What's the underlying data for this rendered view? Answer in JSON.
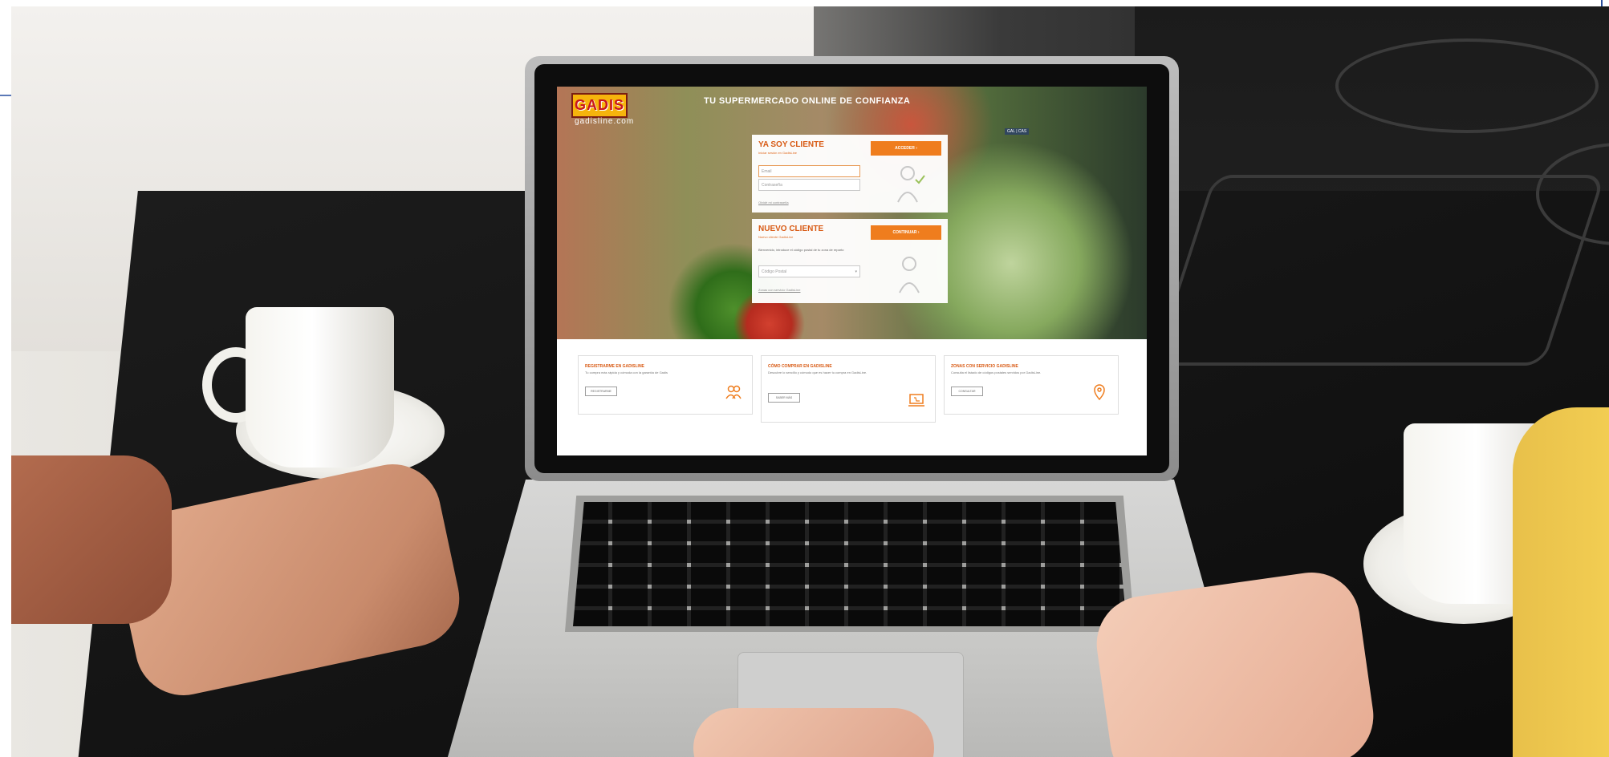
{
  "site": {
    "logo": "GADIS",
    "domain": "gadisline.com",
    "tagline": "TU SUPERMERCADO ONLINE DE CONFIANZA",
    "language": "GAL | CAS"
  },
  "login": {
    "title": "YA SOY CLIENTE",
    "subtitle": "Iniciar sesión en GadisLine",
    "button": "ACCEDER",
    "email_placeholder": "Email",
    "password_placeholder": "Contraseña",
    "forgot": "Olvidé mi contraseña"
  },
  "signup": {
    "title": "NUEVO CLIENTE",
    "subtitle": "Nuevo cliente GadisLine",
    "button": "CONTINUAR",
    "description": "Bienvenido, introduce el código postal de tu zona de reparto",
    "postal_placeholder": "Código Postal",
    "link": "Zonas con servicio GadisLine"
  },
  "cards": [
    {
      "title": "REGISTRARME EN GADISLINE",
      "desc": "Tu compra más rápida y cómoda con la garantía de Gadis",
      "button": "REGISTRARME",
      "icon": "users-icon"
    },
    {
      "title": "CÓMO COMPRAR EN GADISLINE",
      "desc": "Descubre lo sencillo y cómodo que es hacer tu compra en GadisLine.",
      "button": "SABER MÁS",
      "icon": "laptop-cart-icon"
    },
    {
      "title": "ZONAS CON SERVICIO GADISLINE",
      "desc": "Consulta el listado de códigos postales servidos por GadisLine.",
      "button": "CONSULTAR",
      "icon": "location-pin-icon"
    }
  ],
  "colors": {
    "accent": "#ef7d1e",
    "brand_yellow": "#f6b40c",
    "brand_red": "#c8161d"
  }
}
